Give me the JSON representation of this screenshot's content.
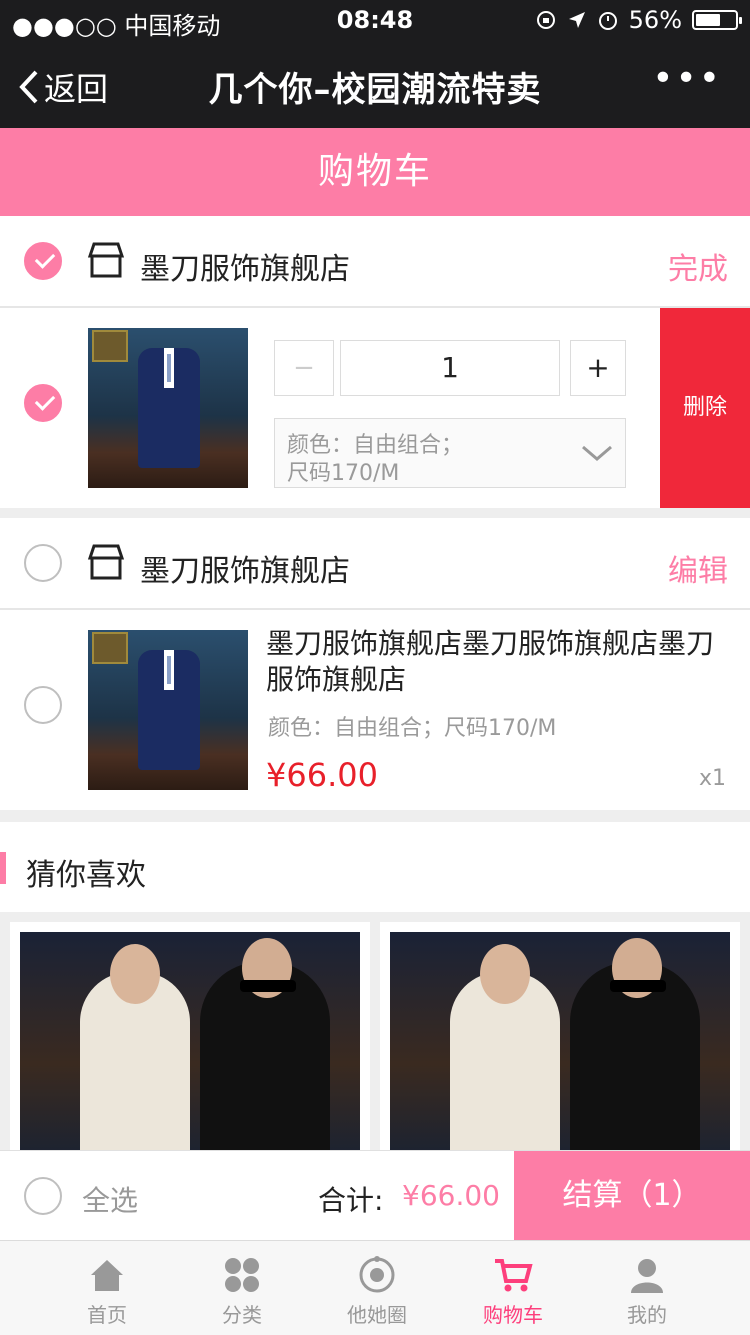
{
  "status_bar": {
    "carrier": "●●●○○ 中国移动",
    "time": "08:48",
    "battery": "56%"
  },
  "nav": {
    "back_label": "返回",
    "title": "几个你–校园潮流特卖",
    "more": "•••"
  },
  "page_header": "购物车",
  "shops": [
    {
      "name": "墨刀服饰旗舰店",
      "action": "完成",
      "checked": true,
      "item": {
        "quantity": "1",
        "minus": "−",
        "plus": "+",
        "spec_line1": "颜色：自由组合；",
        "spec_line2": "尺码170/M",
        "delete_label": "删除",
        "checked": true
      }
    },
    {
      "name": "墨刀服饰旗舰店",
      "action": "编辑",
      "checked": false,
      "item": {
        "title": "墨刀服饰旗舰店墨刀服饰旗舰店墨刀服饰旗舰店",
        "spec": "颜色：自由组合；尺码170/M",
        "price": "¥66.00",
        "count": "x1",
        "checked": false
      }
    }
  ],
  "recommend": {
    "title": "猜你喜欢"
  },
  "checkout": {
    "select_all": "全选",
    "total_label": "合计:",
    "total_value": "¥66.00",
    "button": "结算（1）"
  },
  "tabbar": [
    {
      "label": "首页",
      "icon": "home-icon",
      "active": false
    },
    {
      "label": "分类",
      "icon": "category-icon",
      "active": false
    },
    {
      "label": "他她圈",
      "icon": "circle-icon",
      "active": false
    },
    {
      "label": "购物车",
      "icon": "cart-icon",
      "active": true
    },
    {
      "label": "我的",
      "icon": "user-icon",
      "active": false
    }
  ],
  "colors": {
    "accent": "#fd7da6",
    "delete": "#f0283a",
    "price": "#e8202a",
    "tab_active": "#fd3f7c",
    "nav_bg": "#1c1c1e"
  }
}
